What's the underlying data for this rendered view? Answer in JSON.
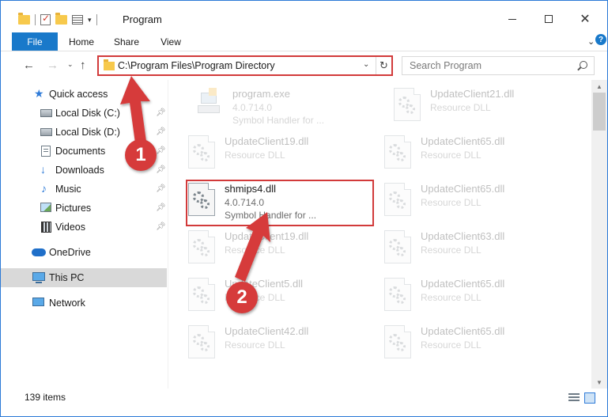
{
  "window": {
    "title": "Program"
  },
  "ribbon": {
    "tabs": [
      {
        "label": "File"
      },
      {
        "label": "Home"
      },
      {
        "label": "Share"
      },
      {
        "label": "View"
      }
    ],
    "help": "?"
  },
  "address": {
    "path": "C:\\Program Files\\Program Directory"
  },
  "search": {
    "placeholder": "Search Program"
  },
  "sidebar": {
    "items": [
      {
        "label": "Quick access",
        "icon": "star-icon"
      },
      {
        "label": "Local Disk (C:)",
        "icon": "disk-icon"
      },
      {
        "label": "Local Disk (D:)",
        "icon": "disk-icon"
      },
      {
        "label": "Documents",
        "icon": "documents-icon"
      },
      {
        "label": "Downloads",
        "icon": "downloads-icon"
      },
      {
        "label": "Music",
        "icon": "music-icon"
      },
      {
        "label": "Pictures",
        "icon": "pictures-icon"
      },
      {
        "label": "Videos",
        "icon": "videos-icon"
      },
      {
        "label": "OneDrive",
        "icon": "onedrive-icon"
      },
      {
        "label": "This PC",
        "icon": "this-pc-icon"
      },
      {
        "label": "Network",
        "icon": "network-icon"
      }
    ]
  },
  "files": [
    {
      "name": "program.exe",
      "line2": "4.0.714.0",
      "line3": "Symbol Handler for ..."
    },
    {
      "name": "UpdateClient21.dll",
      "line2": "Resource DLL",
      "line3": ""
    },
    {
      "name": "UpdateClient19.dll",
      "line2": "Resource DLL",
      "line3": ""
    },
    {
      "name": "UpdateClient65.dll",
      "line2": "Resource DLL",
      "line3": ""
    },
    {
      "name": "shmips4.dll",
      "line2": "4.0.714.0",
      "line3": "Symbol Handler for ..."
    },
    {
      "name": "UpdateClient65.dll",
      "line2": "Resource DLL",
      "line3": ""
    },
    {
      "name": "UpdateClient19.dll",
      "line2": "Resource DLL",
      "line3": ""
    },
    {
      "name": "UpdateClient63.dll",
      "line2": "Resource DLL",
      "line3": ""
    },
    {
      "name": "UpdateClient5.dll",
      "line2": "Resource DLL",
      "line3": ""
    },
    {
      "name": "UpdateClient65.dll",
      "line2": "Resource DLL",
      "line3": ""
    },
    {
      "name": "UpdateClient42.dll",
      "line2": "Resource DLL",
      "line3": ""
    },
    {
      "name": "UpdateClient65.dll",
      "line2": "Resource DLL",
      "line3": ""
    }
  ],
  "status": {
    "item_count": "139 items"
  },
  "annotations": {
    "step1": "1",
    "step2": "2"
  },
  "colors": {
    "accent": "#1979ca",
    "highlight": "#d23a3a",
    "selected_bg": "#d9d9d9"
  }
}
